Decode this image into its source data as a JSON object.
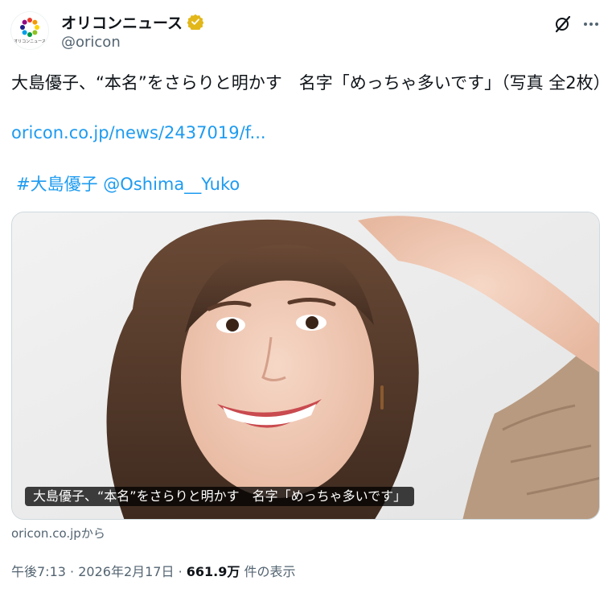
{
  "account": {
    "display_name": "オリコンニュース",
    "handle": "@oricon",
    "verified_icon": "gold-verified-badge",
    "avatar_icon": "oricon-news-logo",
    "avatar_caption": "オリコンニュース"
  },
  "actions": {
    "grok_icon": "grok-icon",
    "more_icon": "more-dots-icon"
  },
  "tweet": {
    "text": "大島優子、“本名”をさらりと明かす　名字「めっちゃ多いです」（写真 全2枚）",
    "link": "oricon.co.jp/news/2437019/f...",
    "hashtag": "#大島優子",
    "mention": "@Oshima__Yuko"
  },
  "card": {
    "caption": "大島優子、“本名”をさらりと明かす　名字「めっちゃ多いです」",
    "source": "oricon.co.jpから"
  },
  "meta": {
    "time": "午後7:13",
    "separator": "·",
    "date": "2026年2月17日",
    "views": "661.9万",
    "views_suffix": "件の表示"
  },
  "colors": {
    "link": "#1d9bf0",
    "text": "#0f1419",
    "secondary": "#536471",
    "verified_gold": "#e2b719"
  }
}
